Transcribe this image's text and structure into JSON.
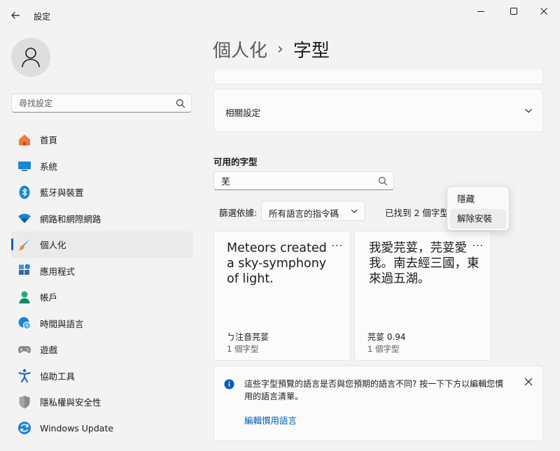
{
  "window": {
    "title": "設定",
    "minimize_icon": "minimize-icon",
    "maximize_icon": "maximize-icon",
    "close_icon": "close-icon"
  },
  "sidebar": {
    "search_placeholder": "尋找設定",
    "items": [
      {
        "label": "首頁",
        "icon": "home-icon",
        "color": "#e8663a"
      },
      {
        "label": "系統",
        "icon": "display-icon",
        "color": "#0f79d0"
      },
      {
        "label": "藍牙與裝置",
        "icon": "bluetooth-icon",
        "color": "#0f79d0"
      },
      {
        "label": "網路和網際網路",
        "icon": "wifi-icon",
        "color": "#0f79d0"
      },
      {
        "label": "個人化",
        "icon": "brush-icon",
        "color": "#e08a3c",
        "active": true
      },
      {
        "label": "應用程式",
        "icon": "apps-icon",
        "color": "#3b6ea8"
      },
      {
        "label": "帳戶",
        "icon": "person-icon",
        "color": "#1aa36b"
      },
      {
        "label": "時間與語言",
        "icon": "clock-globe-icon",
        "color": "#0f79d0"
      },
      {
        "label": "遊戲",
        "icon": "gamepad-icon",
        "color": "#7a7a7a"
      },
      {
        "label": "協助工具",
        "icon": "accessibility-icon",
        "color": "#1a6fc9"
      },
      {
        "label": "隱私權與安全性",
        "icon": "shield-icon",
        "color": "#7a7a7a"
      },
      {
        "label": "Windows Update",
        "icon": "update-icon",
        "color": "#0f79d0"
      }
    ]
  },
  "breadcrumb": {
    "parent": "個人化",
    "separator": "›",
    "current": "字型"
  },
  "related": {
    "label": "相關設定"
  },
  "fonts": {
    "section_label": "可用的字型",
    "search_value": "芜",
    "filter_label": "篩選依據:",
    "filter_value": "所有語言的指令碼",
    "found_label": "已找到 2 個字型",
    "cards": [
      {
        "preview": "Meteors created a sky-symphony of light.",
        "name": "ㄅ注音芫荽",
        "count": "1 個字型"
      },
      {
        "preview": "我愛芫荽，芫荽愛我。南去經三國，東來過五湖。",
        "name": "芫荽 0.94",
        "count": "1 個字型"
      }
    ],
    "more_label": "···"
  },
  "context_menu": {
    "items": [
      "隱藏",
      "解除安裝"
    ]
  },
  "info": {
    "text": "這些字型預覽的語言是否與您預期的語言不同? 按一下下方以編輯您慣用的語言清單。",
    "link": "編輯慣用語言"
  },
  "colors": {
    "accent": "#005fb8",
    "background": "#f3f3f3",
    "card": "#fbfbfb"
  }
}
